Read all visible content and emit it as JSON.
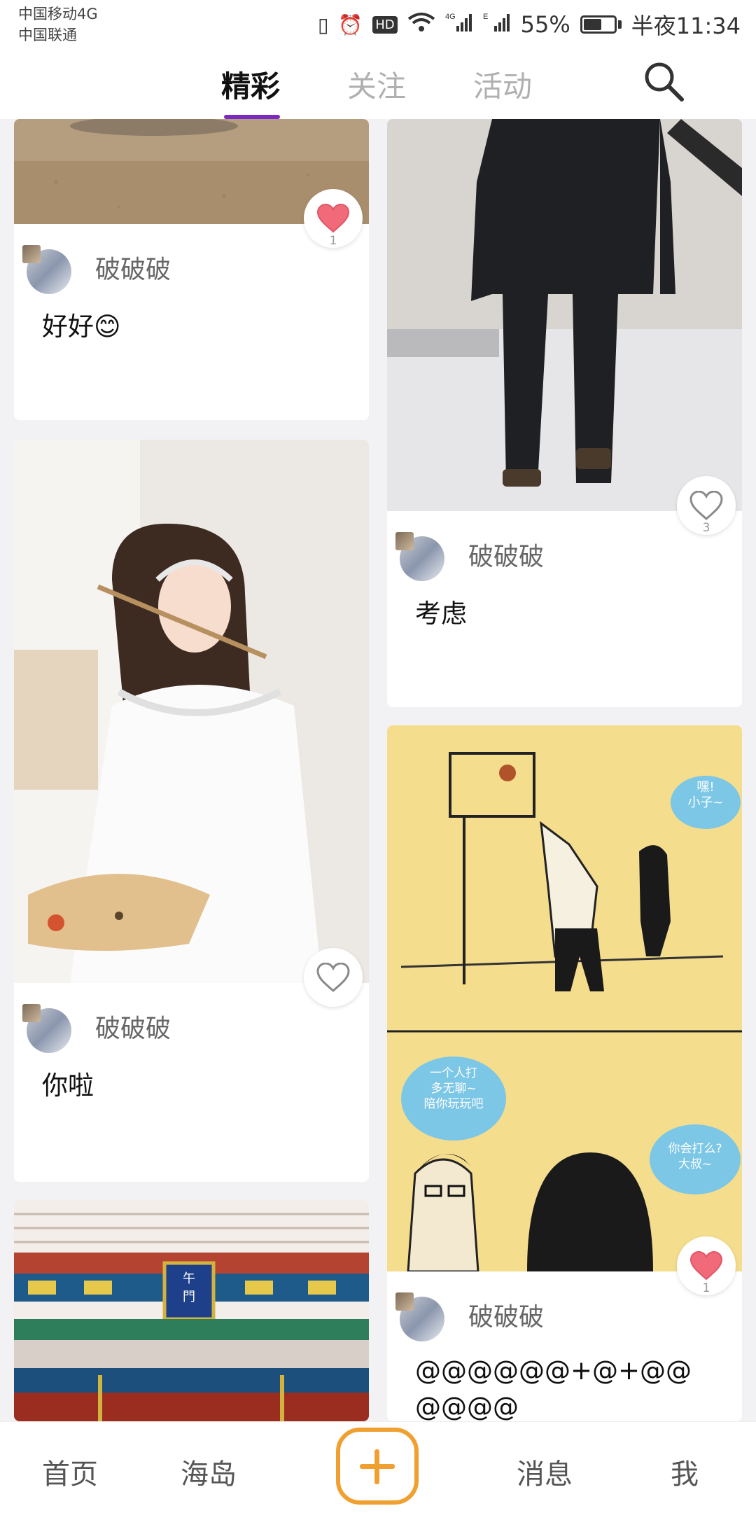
{
  "status_bar": {
    "carrier1": "中国移动4G",
    "carrier2": "中国联通",
    "signal1_label": "4G",
    "signal2_label": "E",
    "battery": "55%",
    "time": "半夜11:34"
  },
  "top_nav": {
    "tabs": [
      {
        "label": "精彩",
        "active": true
      },
      {
        "label": "关注",
        "active": false
      },
      {
        "label": "活动",
        "active": false
      }
    ],
    "search_icon": "search-icon",
    "accent_color": "#7b2bc2"
  },
  "feed": {
    "cards": [
      {
        "user": "破破破",
        "caption": "好好😊",
        "likes": "1",
        "liked": true
      },
      {
        "user": "破破破",
        "caption": "考虑",
        "likes": "3",
        "liked": false
      },
      {
        "user": "破破破",
        "caption": "你啦",
        "likes": "",
        "liked": false
      },
      {
        "user": "破破破",
        "caption": "@@@@@@+@+@@@@@@",
        "likes": "1",
        "liked": true
      }
    ],
    "liked_color": "#f06a7a",
    "comic_bubbles": [
      "嘿!\n小子~",
      "一个人打\n多无聊~\n陪你玩玩吧",
      "你会打么?\n大叔~"
    ],
    "gate_sign": "午\n門"
  },
  "bottom_nav": {
    "items": [
      "首页",
      "海岛",
      "消息",
      "我"
    ],
    "add_button_color": "#f0a030"
  }
}
